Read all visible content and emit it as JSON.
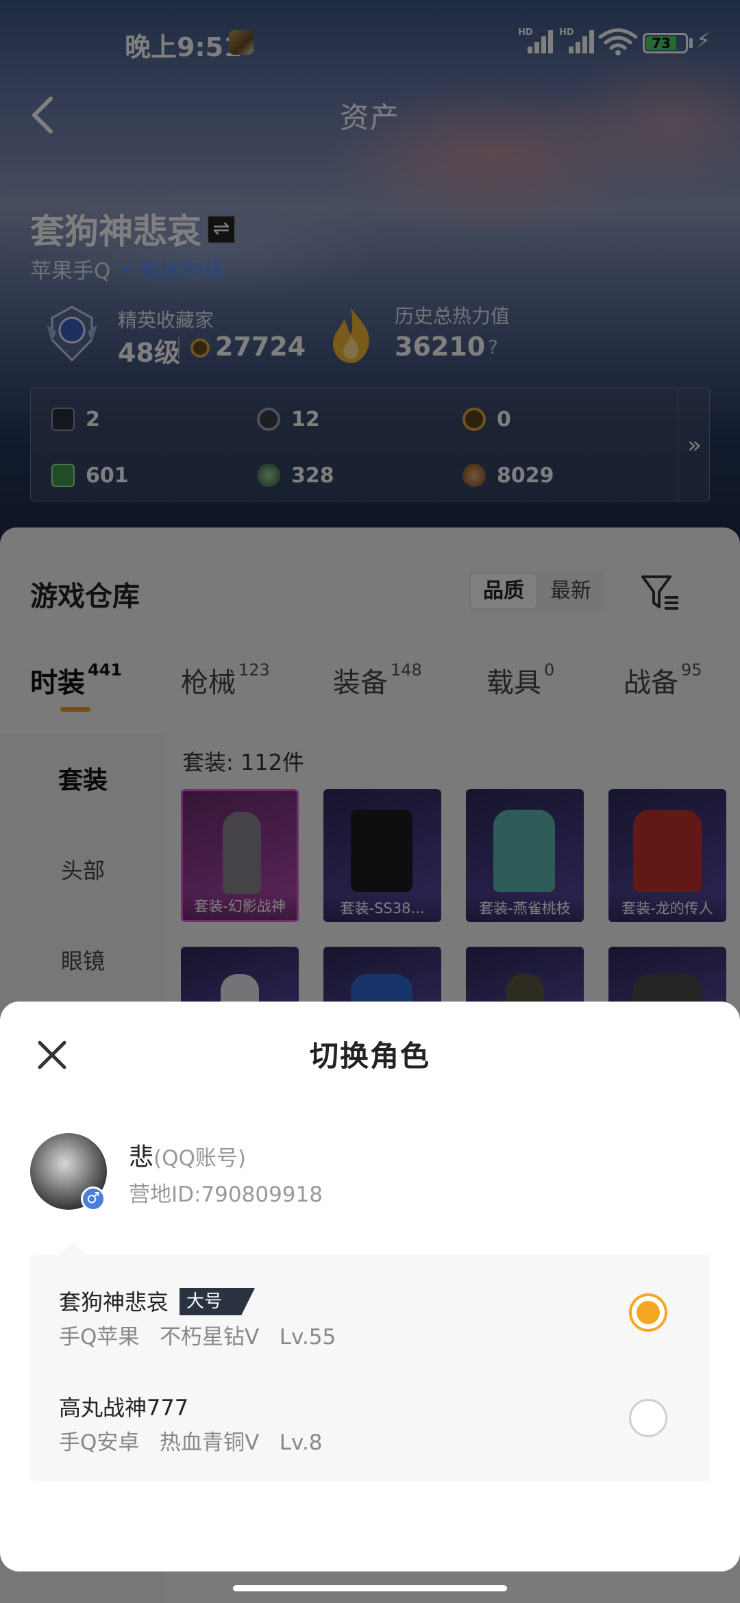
{
  "status_bar": {
    "time": "晚上9:51",
    "hd1": "HD",
    "hd2": "HD",
    "battery": "73"
  },
  "header": {
    "title": "资产"
  },
  "player": {
    "name": "套狗神悲哀",
    "platform": "苹果手Q",
    "online_status": "• 营地在线",
    "rank_title": "精英收藏家",
    "rank_level": "48级",
    "coins": "27724",
    "heat_title": "历史总热力值",
    "heat_value": "36210",
    "heat_help": "?"
  },
  "stats": [
    {
      "icon": "card-icon",
      "value": "2"
    },
    {
      "icon": "round-coin-icon",
      "value": "12"
    },
    {
      "icon": "gold-coin-icon",
      "value": "0"
    },
    {
      "icon": "green-ticket-icon",
      "value": "601"
    },
    {
      "icon": "gem-icon",
      "value": "328"
    },
    {
      "icon": "bronze-coin-icon",
      "value": "8029"
    }
  ],
  "warehouse": {
    "title": "游戏仓库",
    "sort": {
      "quality": "品质",
      "latest": "最新"
    },
    "tabs": [
      {
        "label": "时装",
        "count": "441",
        "active": true
      },
      {
        "label": "枪械",
        "count": "123"
      },
      {
        "label": "装备",
        "count": "148"
      },
      {
        "label": "载具",
        "count": "0"
      },
      {
        "label": "战备",
        "count": "95"
      }
    ],
    "sidebar": [
      "套装",
      "头部",
      "眼镜"
    ],
    "grid_label": "套装: 112件",
    "items": [
      "套装-幻影战神",
      "套装-SS38...",
      "套装-燕雀桃枝",
      "套装-龙的传人"
    ]
  },
  "sheet": {
    "title": "切换角色",
    "user_name": "悲",
    "user_account": "(QQ账号)",
    "user_id": "营地ID:790809918",
    "roles": [
      {
        "name": "套狗神悲哀",
        "tag": "大号",
        "info": "手Q苹果   不朽星钻V   Lv.55",
        "selected": true
      },
      {
        "name": "高丸战神777",
        "info": "手Q安卓   热血青铜V   Lv.8",
        "selected": false
      }
    ]
  },
  "colors": {
    "accent": "#f5a623",
    "online": "#4a90ff",
    "tab_underline": "#f0a020"
  }
}
